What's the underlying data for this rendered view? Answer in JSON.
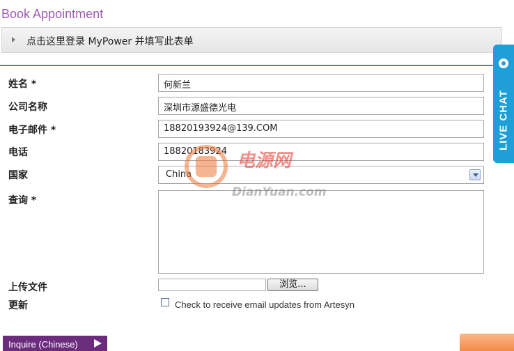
{
  "title": "Book Appointment",
  "login_bar": {
    "text": "点击这里登录 MyPower 并填写此表单"
  },
  "form": {
    "name_label": "姓名 *",
    "name_value": "何新兰",
    "company_label": "公司名称",
    "company_value": "深圳市源盛德光电",
    "email_label": "电子邮件 *",
    "email_value": "18820193924@139.COM",
    "phone_label": "电话",
    "phone_value": "18820183924",
    "country_label": "国家",
    "country_value": "China",
    "inquiry_label": "查询 *",
    "upload_label": "上传文件",
    "browse_label": "浏览...",
    "updates_label": "更新",
    "checkbox_label": "Check to receive email updates from Artesyn"
  },
  "buttons": {
    "inquire": "Inquire (Chinese)"
  },
  "live_chat": {
    "label": "LIVE CHAT"
  },
  "watermark": {
    "cn": "电源网",
    "en": "DianYuan.com"
  },
  "colors": {
    "title": "#a05ab8",
    "divider": "#2b8fcf",
    "inquire_bg": "#6b2c7e",
    "live_chat_bg": "#1e9fd8",
    "orange_tab": "#f28b48"
  }
}
